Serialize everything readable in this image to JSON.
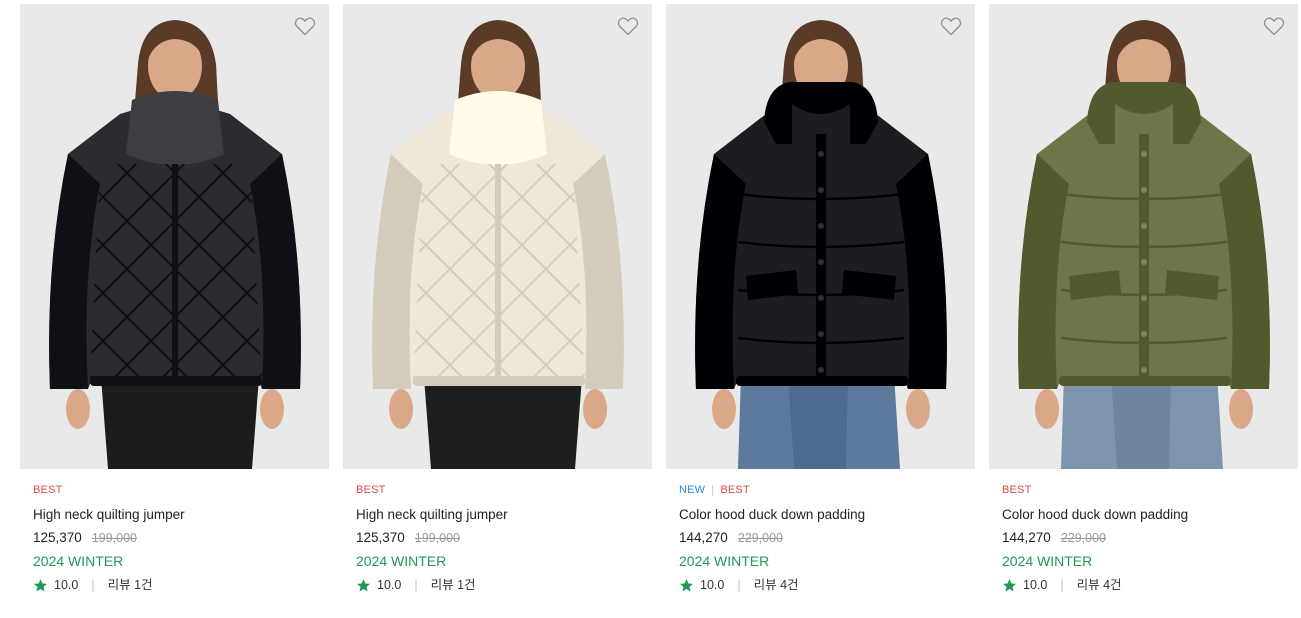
{
  "products": [
    {
      "badges": [
        {
          "label": "BEST",
          "kind": "best"
        }
      ],
      "name": "High neck quilting jumper",
      "sale_price": "125,370",
      "original_price": "199,000",
      "season": "2024 WINTER",
      "rating": "10.0",
      "review_label": "리뷰 1건",
      "jacket_color": "#2a2c31",
      "pants_color": "#1c1c1c",
      "style": "quilt"
    },
    {
      "badges": [
        {
          "label": "BEST",
          "kind": "best"
        }
      ],
      "name": "High neck quilting jumper",
      "sale_price": "125,370",
      "original_price": "199,000",
      "season": "2024 WINTER",
      "rating": "10.0",
      "review_label": "리뷰 1건",
      "jacket_color": "#efe8d8",
      "pants_color": "#1e1e1e",
      "style": "quilt"
    },
    {
      "badges": [
        {
          "label": "NEW",
          "kind": "new"
        },
        {
          "label": "BEST",
          "kind": "best"
        }
      ],
      "name": "Color hood duck down padding",
      "sale_price": "144,270",
      "original_price": "229,000",
      "season": "2024 WINTER",
      "rating": "10.0",
      "review_label": "리뷰 4건",
      "jacket_color": "#1c1d20",
      "pants_color": "#5d7a9c",
      "style": "hood"
    },
    {
      "badges": [
        {
          "label": "BEST",
          "kind": "best"
        }
      ],
      "name": "Color hood duck down padding",
      "sale_price": "144,270",
      "original_price": "229,000",
      "season": "2024 WINTER",
      "rating": "10.0",
      "review_label": "리뷰 4건",
      "jacket_color": "#6e7548",
      "pants_color": "#7d94ad",
      "style": "hood"
    }
  ],
  "icons": {
    "wishlist": "heart-outline-icon",
    "rating": "star-icon"
  },
  "colors": {
    "best": "#e04a4a",
    "new": "#2b8fd6",
    "season": "#1f9a54",
    "star": "#1f9a54",
    "photo_bg": "#e9e9e9"
  }
}
